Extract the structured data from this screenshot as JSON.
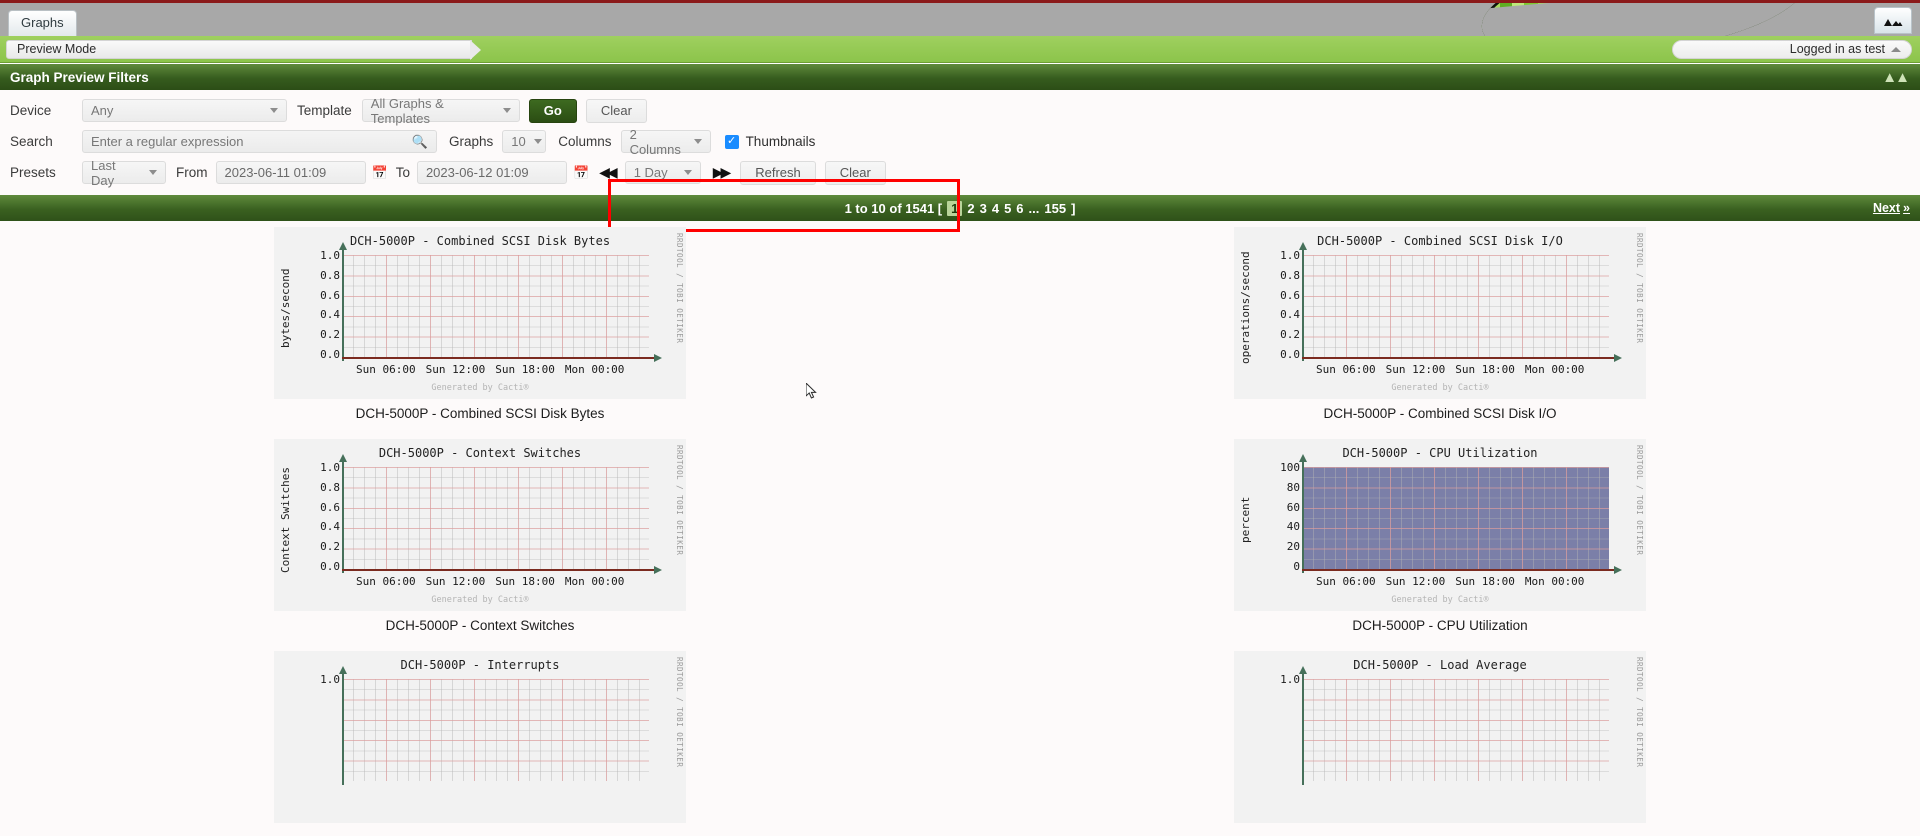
{
  "chrome": {
    "tab_label": "Graphs",
    "breadcrumb": "Preview Mode",
    "login_text": "Logged in as test",
    "graph_icon_name": "graph-view-icon"
  },
  "filters": {
    "panel_title": "Graph Preview Filters",
    "device_label": "Device",
    "device_value": "Any",
    "template_label": "Template",
    "template_value": "All Graphs & Templates",
    "go_label": "Go",
    "clear_label": "Clear",
    "search_label": "Search",
    "search_placeholder": "Enter a regular expression",
    "search_value": "",
    "graphs_label": "Graphs",
    "graphs_value": "10",
    "columns_label": "Columns",
    "columns_value": "2 Columns",
    "thumbnails_label": "Thumbnails",
    "thumbnails_checked": true,
    "presets_label": "Presets",
    "presets_value": "Last Day",
    "from_label": "From",
    "from_value": "2023-06-11 01:09",
    "to_label": "To",
    "to_value": "2023-06-12 01:09",
    "interval_value": "1 Day",
    "refresh_label": "Refresh",
    "clear2_label": "Clear"
  },
  "pagination": {
    "summary": "1 to 10 of 1541  [",
    "current_page": "1",
    "pages": [
      "2",
      "3",
      "4",
      "5",
      "6"
    ],
    "ellipsis": "...",
    "last_page": "155",
    "close_bracket": "]",
    "next_label": "Next",
    "next_glyph": "»",
    "highlight_color": "#ff0000"
  },
  "graph_common": {
    "watermark": "RRDTOOL / TOBI OETIKER",
    "generated_by": "Generated by Cacti®",
    "xticks": [
      "Sun 06:00",
      "Sun 12:00",
      "Sun 18:00",
      "Mon 00:00"
    ]
  },
  "chart_data": [
    {
      "type": "line",
      "title": "DCH-5000P - Combined SCSI Disk Bytes",
      "caption": "DCH-5000P - Combined SCSI Disk Bytes",
      "ylabel": "bytes/second",
      "xlabel": "",
      "yticks": [
        "1.0",
        "0.8",
        "0.6",
        "0.4",
        "0.2",
        "0.0"
      ],
      "ylim": [
        0,
        1.0
      ],
      "xticks": [
        "Sun 06:00",
        "Sun 12:00",
        "Sun 18:00",
        "Mon 00:00"
      ],
      "series": [
        {
          "name": "bytes/second",
          "values": [
            0,
            0,
            0,
            0,
            0
          ]
        }
      ],
      "grid": true,
      "legend": "none"
    },
    {
      "type": "line",
      "title": "DCH-5000P - Combined SCSI Disk I/O",
      "caption": "DCH-5000P - Combined SCSI Disk I/O",
      "ylabel": "operations/second",
      "xlabel": "",
      "yticks": [
        "1.0",
        "0.8",
        "0.6",
        "0.4",
        "0.2",
        "0.0"
      ],
      "ylim": [
        0,
        1.0
      ],
      "xticks": [
        "Sun 06:00",
        "Sun 12:00",
        "Sun 18:00",
        "Mon 00:00"
      ],
      "series": [
        {
          "name": "operations/second",
          "values": [
            0,
            0,
            0,
            0,
            0
          ]
        }
      ],
      "grid": true,
      "legend": "none"
    },
    {
      "type": "line",
      "title": "DCH-5000P - Context Switches",
      "caption": "DCH-5000P - Context Switches",
      "ylabel": "Context Switches",
      "xlabel": "",
      "yticks": [
        "1.0",
        "0.8",
        "0.6",
        "0.4",
        "0.2",
        "0.0"
      ],
      "ylim": [
        0,
        1.0
      ],
      "xticks": [
        "Sun 06:00",
        "Sun 12:00",
        "Sun 18:00",
        "Mon 00:00"
      ],
      "series": [
        {
          "name": "Context Switches",
          "values": [
            0,
            0,
            0,
            0,
            0
          ]
        }
      ],
      "grid": true,
      "legend": "none"
    },
    {
      "type": "area",
      "title": "DCH-5000P - CPU Utilization",
      "caption": "DCH-5000P - CPU Utilization",
      "ylabel": "percent",
      "xlabel": "",
      "yticks": [
        "100",
        "80",
        "60",
        "40",
        "20",
        "0"
      ],
      "ylim": [
        0,
        100
      ],
      "xticks": [
        "Sun 06:00",
        "Sun 12:00",
        "Sun 18:00",
        "Mon 00:00"
      ],
      "series": [
        {
          "name": "percent",
          "values": [
            100,
            100,
            100,
            100,
            100
          ],
          "color": "#7b7fa8"
        }
      ],
      "grid": true,
      "legend": "none"
    },
    {
      "type": "line",
      "title": "DCH-5000P - Interrupts",
      "caption": "DCH-5000P - Interrupts",
      "ylabel": "",
      "xlabel": "",
      "yticks": [
        "1.0"
      ],
      "ylim": [
        0,
        1.0
      ],
      "xticks": [],
      "series": [
        {
          "name": "Interrupts",
          "values": [
            0,
            0
          ]
        }
      ],
      "grid": true,
      "legend": "none"
    },
    {
      "type": "line",
      "title": "DCH-5000P - Load Average",
      "caption": "DCH-5000P - Load Average",
      "ylabel": "",
      "xlabel": "",
      "yticks": [
        "1.0"
      ],
      "ylim": [
        0,
        1.0
      ],
      "xticks": [],
      "series": [
        {
          "name": "Load Average",
          "values": [
            0,
            0
          ]
        }
      ],
      "grid": true,
      "legend": "none"
    }
  ]
}
